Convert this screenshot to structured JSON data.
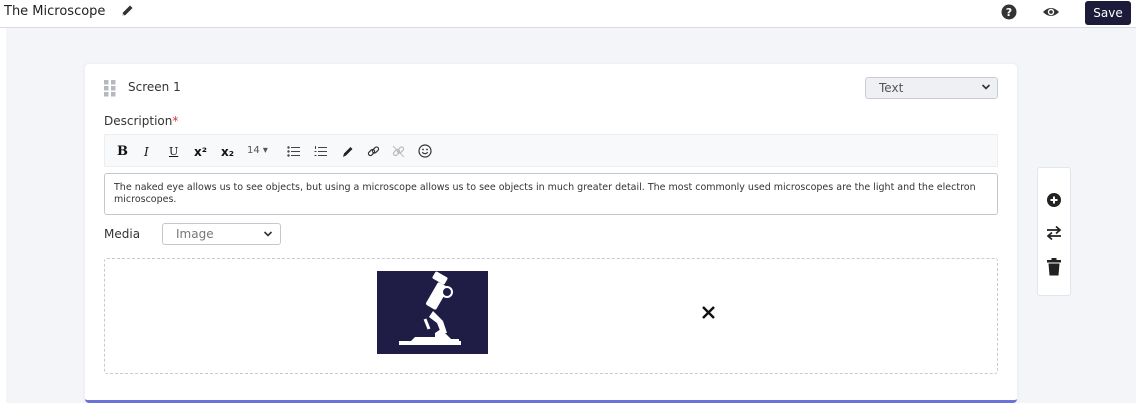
{
  "header": {
    "title": "The Microscope",
    "save_label": "Save",
    "icons": [
      "pencil-icon",
      "help-icon",
      "eye-icon"
    ]
  },
  "screen": {
    "label": "Screen 1",
    "type_value": "Text",
    "description_label": "Description",
    "required_mark": "*",
    "description_text": "The naked eye allows us to see objects, but using a microscope allows us to see objects in much greater detail. The most commonly used microscopes are the light and the electron microscopes.",
    "media_label": "Media",
    "media_value": "Image",
    "media_image": "microscope-image"
  },
  "toolbar": {
    "bold": "B",
    "italic": "I",
    "underline": "U",
    "superscript": "x²",
    "subscript": "x₂",
    "font_size": "14"
  },
  "side_actions": [
    "add-icon",
    "swap-icon",
    "delete-icon"
  ],
  "colors": {
    "save_bg": "#1c1b3a",
    "accent_border": "#6b72d8",
    "image_bg": "#1f1d45"
  }
}
